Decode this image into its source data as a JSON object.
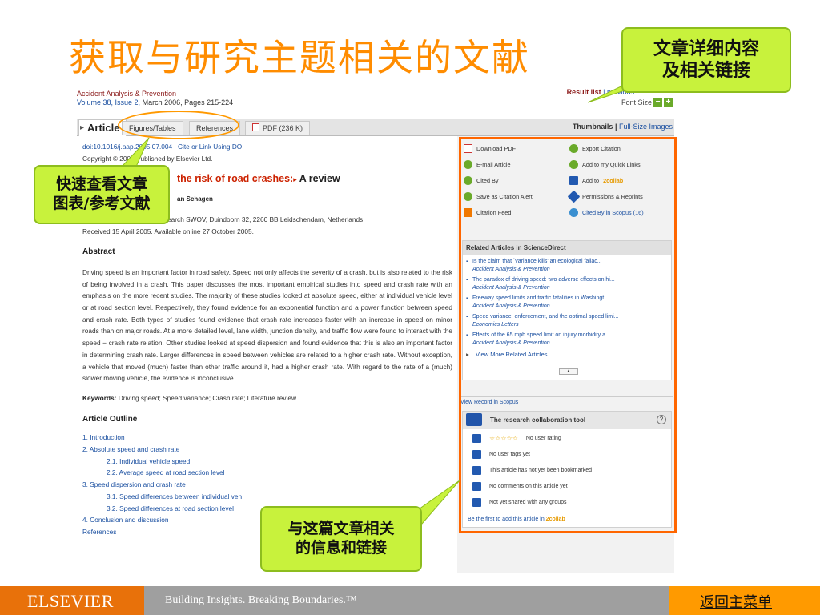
{
  "slide": {
    "title": "获取与研究主题相关的文献"
  },
  "callouts": {
    "top_right": [
      "文章详细内容",
      "及相关链接"
    ],
    "left": [
      "快速查看文章",
      "图表/参考文献"
    ],
    "bottom": [
      "与这篇文章相关",
      "的信息和链接"
    ]
  },
  "article_page": {
    "journal": "Accident Analysis & Prevention",
    "volume": "Volume 38, Issue 2,",
    "date_pages": "March 2006, Pages 215-224",
    "result_list": "Result list",
    "previous": "previous",
    "font_size_label": "Font Size",
    "tabs": {
      "article": "Article",
      "figures": "Figures/Tables",
      "references": "References",
      "pdf": "PDF (236 K)"
    },
    "thumbnails": "Thumbnails",
    "full_size": "Full-Size Images",
    "doi": "doi:10.1016/j.aap.2005.07.004",
    "cite": "Cite or Link Using DOI",
    "copyright": "Copyright © 2005 Published by Elsevier Ltd.",
    "title_part": "the risk of road crashes:",
    "title_rest": "A review",
    "authors_part": "an Schagen",
    "affiliation": "Institute for Road Safety Research SWOV, Duindoorn 32, 2260 BB Leidschendam, Netherlands",
    "received": "Received 15 April 2005.  Available online 27 October 2005.",
    "abstract_heading": "Abstract",
    "abstract": "Driving speed is an important factor in road safety. Speed not only affects the severity of a crash, but is also related to the risk of being involved in a crash. This paper discusses the most important empirical studies into speed and crash rate with an emphasis on the more recent studies. The majority of these studies looked at absolute speed, either at individual vehicle level or at road section level. Respectively, they found evidence for an exponential function and a power function between speed and crash rate. Both types of studies found evidence that crash rate increases faster with an increase in speed on minor roads than on major roads. At a more detailed level, lane width, junction density, and traffic flow were found to interact with the speed − crash rate relation. Other studies looked at speed dispersion and found evidence that this is also an important factor in determining crash rate. Larger differences in speed between vehicles are related to a higher crash rate. Without exception, a vehicle that moved (much) faster than other traffic around it, had a higher crash rate. With regard to the rate of a (much) slower moving vehicle, the evidence is inconclusive.",
    "keywords_label": "Keywords:",
    "keywords": "Driving speed; Speed variance; Crash rate; Literature review",
    "outline_heading": "Article Outline",
    "outline": [
      {
        "text": "1. Introduction",
        "sub": false
      },
      {
        "text": "2. Absolute speed and crash rate",
        "sub": false
      },
      {
        "text": "2.1. Individual vehicle speed",
        "sub": true
      },
      {
        "text": "2.2. Average speed at road section level",
        "sub": true
      },
      {
        "text": "3. Speed dispersion and crash rate",
        "sub": false
      },
      {
        "text": "3.1. Speed differences between individual veh",
        "sub": true
      },
      {
        "text": "3.2. Speed differences at road section level",
        "sub": true
      },
      {
        "text": "4. Conclusion and discussion",
        "sub": false
      },
      {
        "text": "References",
        "sub": false
      }
    ]
  },
  "sidebar": {
    "actions": {
      "download_pdf": "Download PDF",
      "export_citation": "Export Citation",
      "email_article": "E-mail Article",
      "quick_links": "Add to my Quick Links",
      "cited_by": "Cited By",
      "add_to": "Add to",
      "collab": "2collab",
      "save_alert": "Save as Citation Alert",
      "permissions": "Permissions & Reprints",
      "citation_feed": "Citation Feed",
      "cited_scopus": "Cited By in Scopus (16)"
    },
    "related_heading": "Related Articles in ScienceDirect",
    "related": [
      {
        "title": "Is the claim that `variance kills' an ecological fallac...",
        "journal": "Accident Analysis & Prevention"
      },
      {
        "title": "The paradox of driving speed: two adverse effects on hi...",
        "journal": "Accident Analysis & Prevention"
      },
      {
        "title": "Freeway speed limits and traffic fatalities in Washingt...",
        "journal": "Accident Analysis & Prevention"
      },
      {
        "title": "Speed variance, enforcement, and the optimal speed limi...",
        "journal": "Economics Letters"
      },
      {
        "title": "Effects of the 65 mph speed limit on injury morbidity a...",
        "journal": "Accident Analysis & Prevention"
      }
    ],
    "view_more": "View More Related Articles",
    "view_scopus": "View Record in Scopus",
    "collab_title": "The research collaboration tool",
    "collab_help": "?",
    "rating_stars": "☆☆☆☆☆",
    "no_rating": "No user rating",
    "no_tags": "No user tags yet",
    "not_bookmarked": "This article has not yet been bookmarked",
    "no_comments": "No comments on this article yet",
    "not_shared": "Not yet shared with any groups",
    "be_first": "Be the first to add this article in",
    "collab_logo": "2collab"
  },
  "footer": {
    "brand": "ELSEVIER",
    "tagline": "Building Insights. Breaking Boundaries.™",
    "back": "返回主菜单"
  },
  "colors": {
    "title_orange": "#ff8c00",
    "callout_green": "#c8f23c",
    "highlight_orange": "#ff6600",
    "link_blue": "#1a4fa0"
  }
}
